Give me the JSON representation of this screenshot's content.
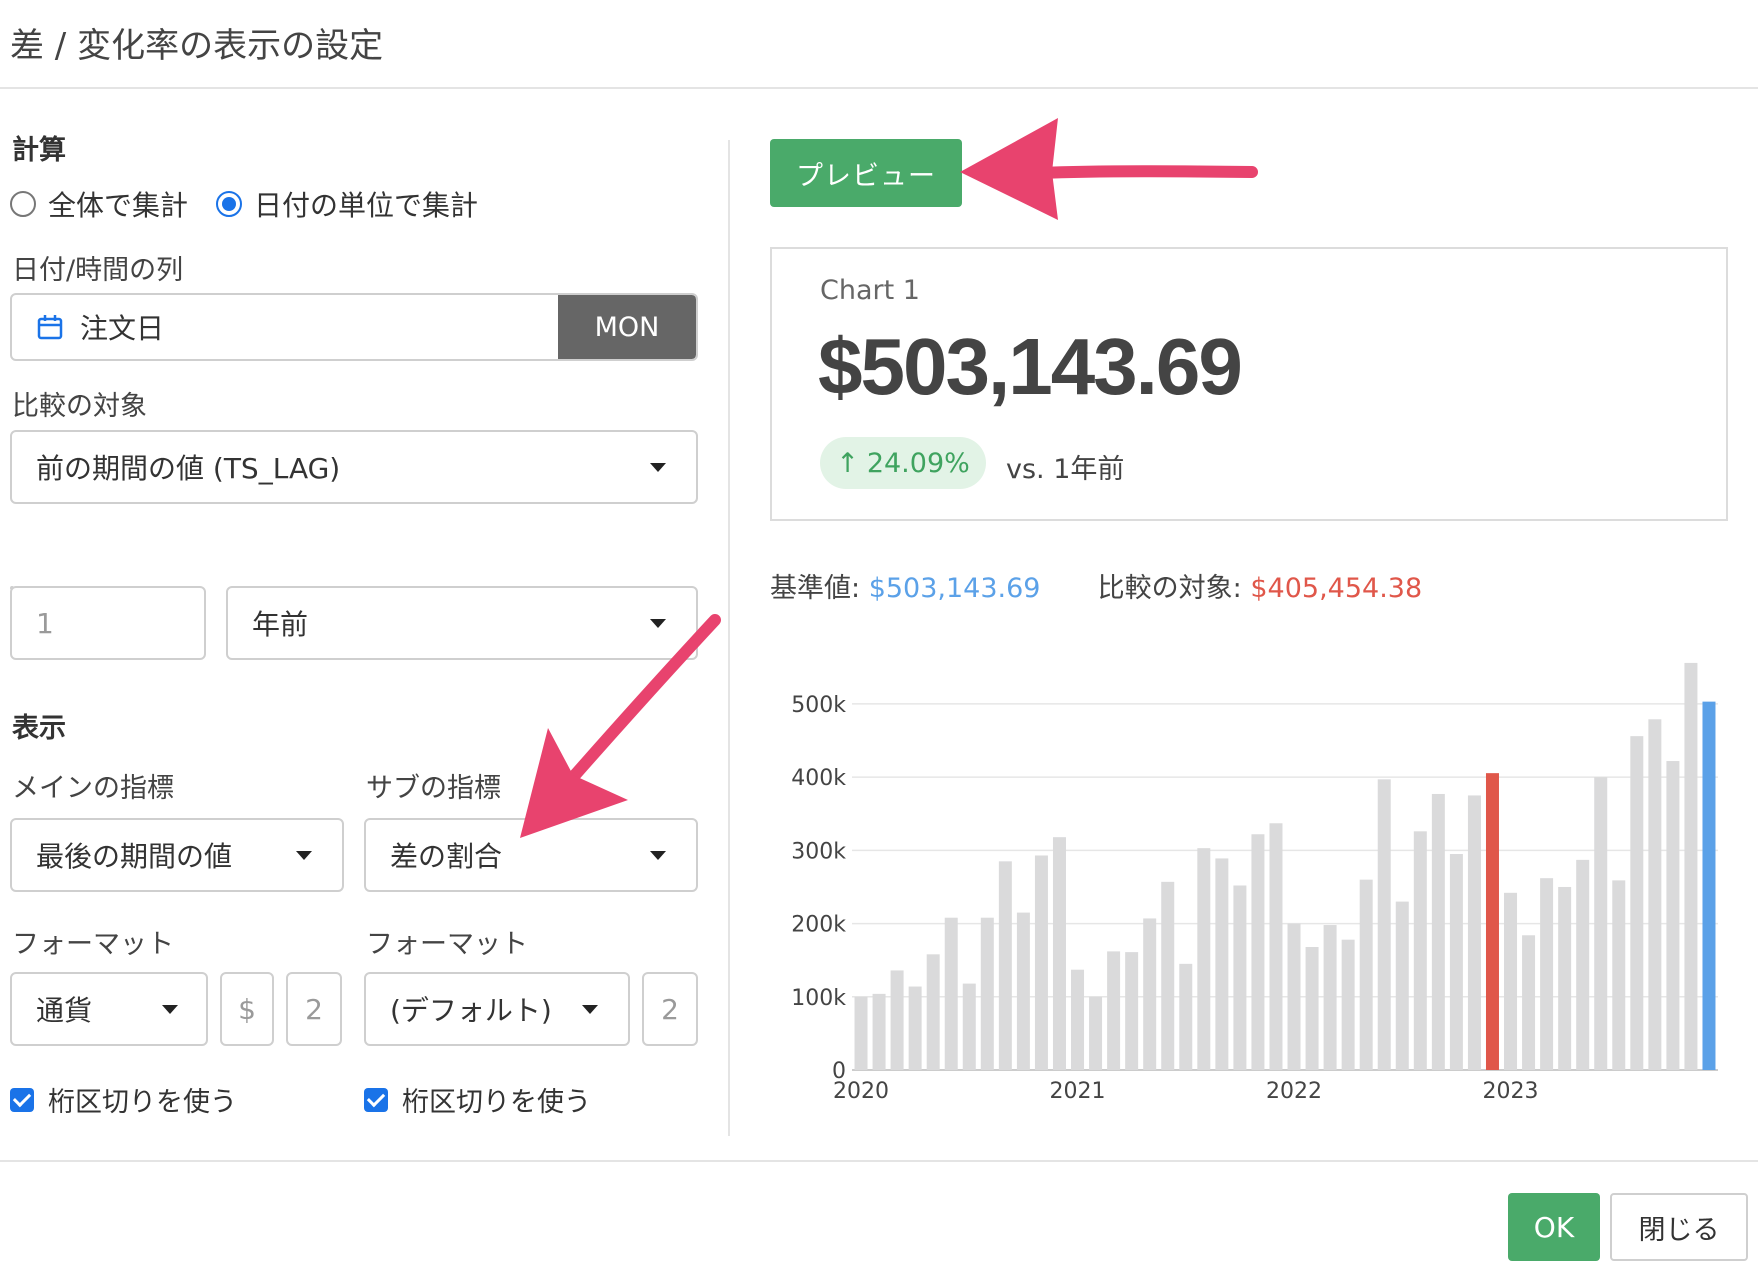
{
  "dialog": {
    "title": "差 / 変化率の表示の設定"
  },
  "calc": {
    "heading": "計算",
    "radio_all": "全体で集計",
    "radio_date": "日付の単位で集計",
    "date_column_label": "日付/時間の列",
    "date_column_value": "注文日",
    "date_unit": "MON",
    "compare_label": "比較の対象",
    "compare_value": "前の期間の値 (TS_LAG)",
    "lag_placeholder": "1",
    "lag_unit": "年前"
  },
  "display": {
    "heading": "表示",
    "main_label": "メインの指標",
    "main_value": "最後の期間の値",
    "sub_label": "サブの指標",
    "sub_value": "差の割合",
    "format_label_main": "フォーマット",
    "format_label_sub": "フォーマット",
    "main_format": "通貨",
    "main_currency": "$",
    "main_digits": "2",
    "sub_format": "(デフォルト)",
    "sub_digits": "2",
    "separator_main": "桁区切りを使う",
    "separator_sub": "桁区切りを使う"
  },
  "preview": {
    "button": "プレビュー",
    "card_title": "Chart 1",
    "card_value": "$503,143.69",
    "change_arrow": "↑",
    "change_value": "24.09%",
    "vs_text": "vs. 1年前",
    "base_label": "基準値:",
    "base_value": "$503,143.69",
    "target_label": "比較の対象:",
    "target_value": "$405,454.38"
  },
  "footer": {
    "ok": "OK",
    "close": "閉じる"
  },
  "colors": {
    "green": "#4aaa6a",
    "bar": "#dadadb",
    "highlight_red": "#e0574a",
    "highlight_blue": "#5ba1e8",
    "annotation_pink": "#e8436e"
  },
  "chart_data": {
    "type": "bar",
    "title": "",
    "xlabel": "",
    "ylabel": "",
    "ylim": [
      0,
      560000
    ],
    "y_ticks": [
      0,
      100000,
      200000,
      300000,
      400000,
      500000
    ],
    "y_tick_labels": [
      "0",
      "100k",
      "200k",
      "300k",
      "400k",
      "500k"
    ],
    "x_tick_labels": [
      "2020",
      "2021",
      "2022",
      "2023"
    ],
    "x_tick_indices": [
      0,
      12,
      24,
      36
    ],
    "values": [
      100000,
      104000,
      136000,
      114000,
      158000,
      208000,
      118000,
      208000,
      285000,
      215000,
      293000,
      318000,
      137000,
      100000,
      162000,
      161000,
      207000,
      257000,
      145000,
      303000,
      289000,
      252000,
      322000,
      337000,
      200000,
      168000,
      198000,
      178000,
      260000,
      397000,
      230000,
      326000,
      377000,
      295000,
      375000,
      405454.38,
      242000,
      184000,
      262000,
      250000,
      287000,
      400000,
      259000,
      456000,
      479000,
      422000,
      556000,
      503143.69
    ],
    "highlight": {
      "35": "red",
      "47": "blue"
    }
  }
}
